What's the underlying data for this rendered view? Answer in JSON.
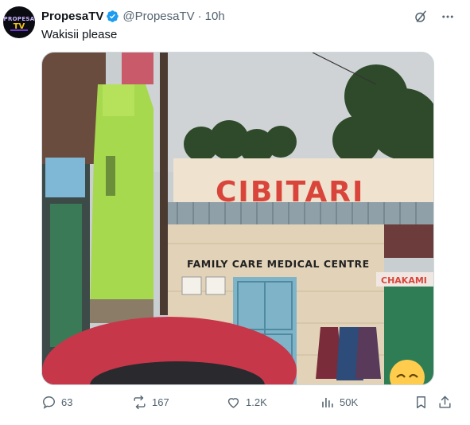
{
  "tweet": {
    "display_name": "PropesaTV",
    "handle": "@PropesaTV",
    "separator": "·",
    "time": "10h",
    "text": "Wakisii please",
    "avatar_label": "PROPESA",
    "avatar_tv": "TV",
    "icons": {
      "verified": "verified-badge-icon",
      "grok": "grok-icon",
      "more": "more-options-icon",
      "reply": "reply-icon",
      "repost": "repost-icon",
      "like": "like-icon",
      "views": "views-icon",
      "bookmark": "bookmark-icon",
      "share": "share-icon"
    }
  },
  "media": {
    "sign_main": "CIBITARI",
    "sign_clinic": "FAMILY CARE MEDICAL CENTRE",
    "sign_side": "CHAKAMI"
  },
  "stats": {
    "replies": "63",
    "reposts": "167",
    "likes": "1.2K",
    "views": "50K"
  },
  "colors": {
    "accent": "#1d9bf0",
    "secondary_text": "#536471",
    "sign_red": "#d9453a",
    "green_building": "#a6d94e"
  }
}
